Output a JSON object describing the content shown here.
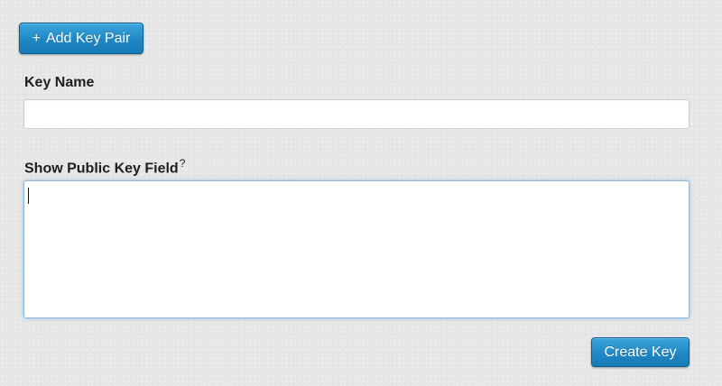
{
  "add_key_pair_button": {
    "icon": "+",
    "label": "Add Key Pair"
  },
  "key_name": {
    "label": "Key Name",
    "value": ""
  },
  "public_key": {
    "label": "Show Public Key Field",
    "help_marker": "?",
    "value": ""
  },
  "create_key_button": {
    "label": "Create Key"
  }
}
